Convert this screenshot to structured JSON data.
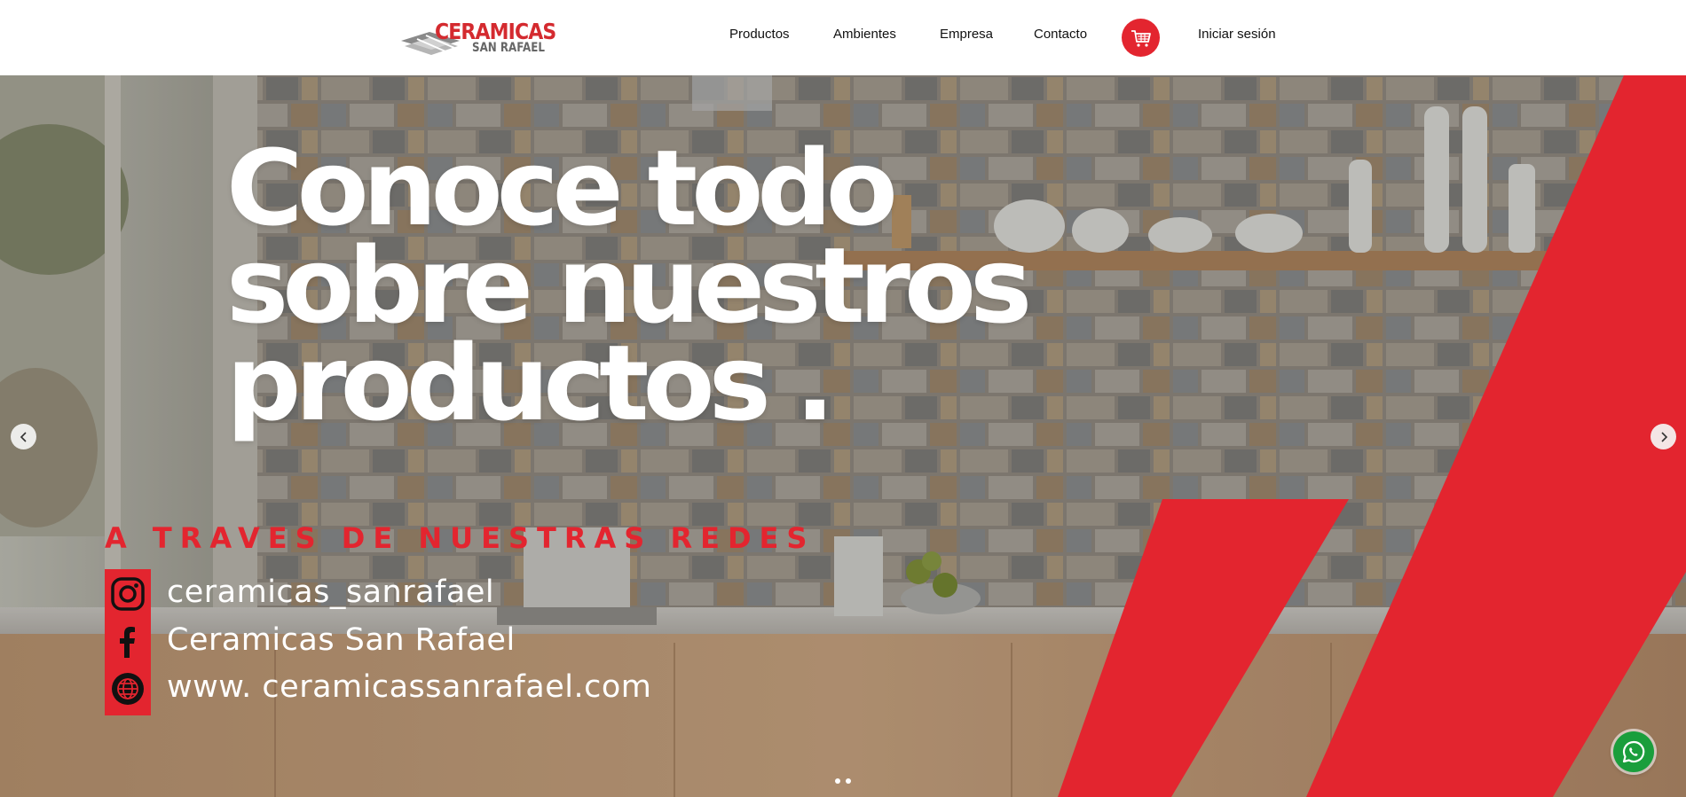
{
  "brand": {
    "name_line1": "CERAMICAS",
    "name_line2": "SAN RAFAEL"
  },
  "nav": {
    "items": [
      {
        "label": "Productos"
      },
      {
        "label": "Ambientes"
      },
      {
        "label": "Empresa"
      },
      {
        "label": "Contacto"
      }
    ],
    "cart_icon": "shopping-cart-icon",
    "login_label": "Iniciar sesión"
  },
  "hero": {
    "headline_lines": [
      "Conoce todo",
      "sobre nuestros",
      "productos ."
    ],
    "subheading": "A TRAVES DE NUESTRAS REDES",
    "socials": [
      {
        "icon": "instagram-icon",
        "text": "ceramicas_sanrafael"
      },
      {
        "icon": "facebook-icon",
        "text": "Ceramicas San Rafael"
      },
      {
        "icon": "globe-icon",
        "text": "www. ceramicassanrafael.com"
      }
    ],
    "prev_icon": "chevron-left-icon",
    "next_icon": "chevron-right-icon",
    "slide_count": 2
  },
  "floating": {
    "whatsapp_icon": "whatsapp-icon"
  },
  "colors": {
    "accent_red": "#e3252f",
    "whatsapp_green": "#1a9e3c",
    "text_dark": "#111111"
  }
}
